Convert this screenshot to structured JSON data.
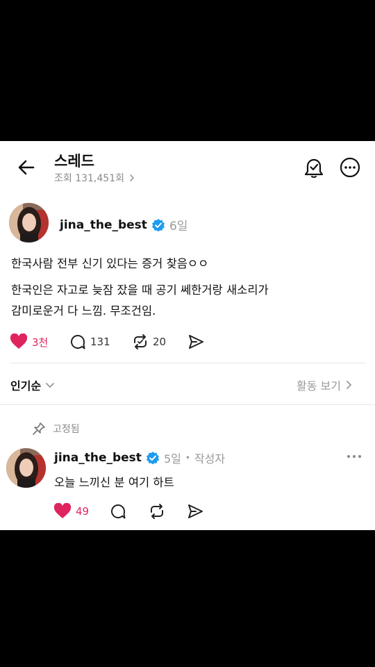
{
  "header": {
    "title": "스레드",
    "views": "조회 131,451회"
  },
  "post": {
    "username": "jina_the_best",
    "age": "6일",
    "line1": "한국사람 전부 신기 있다는 증거 찾음ㅇㅇ",
    "line2": "한국인은 자고로 늦잠 잤을 때 공기 쎄한거랑 새소리가",
    "line3": "감미로운거 다 느낌. 무조건임.",
    "likes": "3천",
    "replies": "131",
    "reposts": "20"
  },
  "sort": {
    "label": "인기순",
    "activity": "활동 보기"
  },
  "comment": {
    "pinned": "고정됨",
    "username": "jina_the_best",
    "age": "5일",
    "separator": "•",
    "role": "작성자",
    "text": "오늘 느끼신 분 여기 하트",
    "likes": "49"
  },
  "colors": {
    "accent_like": "#e0245e",
    "verified": "#1d9bf0"
  },
  "icons": [
    "back-arrow-icon",
    "notification-bell-icon",
    "more-options-icon",
    "chevron-right-icon",
    "verified-badge-icon",
    "heart-icon",
    "reply-icon",
    "repost-icon",
    "share-icon",
    "chevron-down-icon",
    "pin-icon",
    "more-horizontal-icon"
  ]
}
